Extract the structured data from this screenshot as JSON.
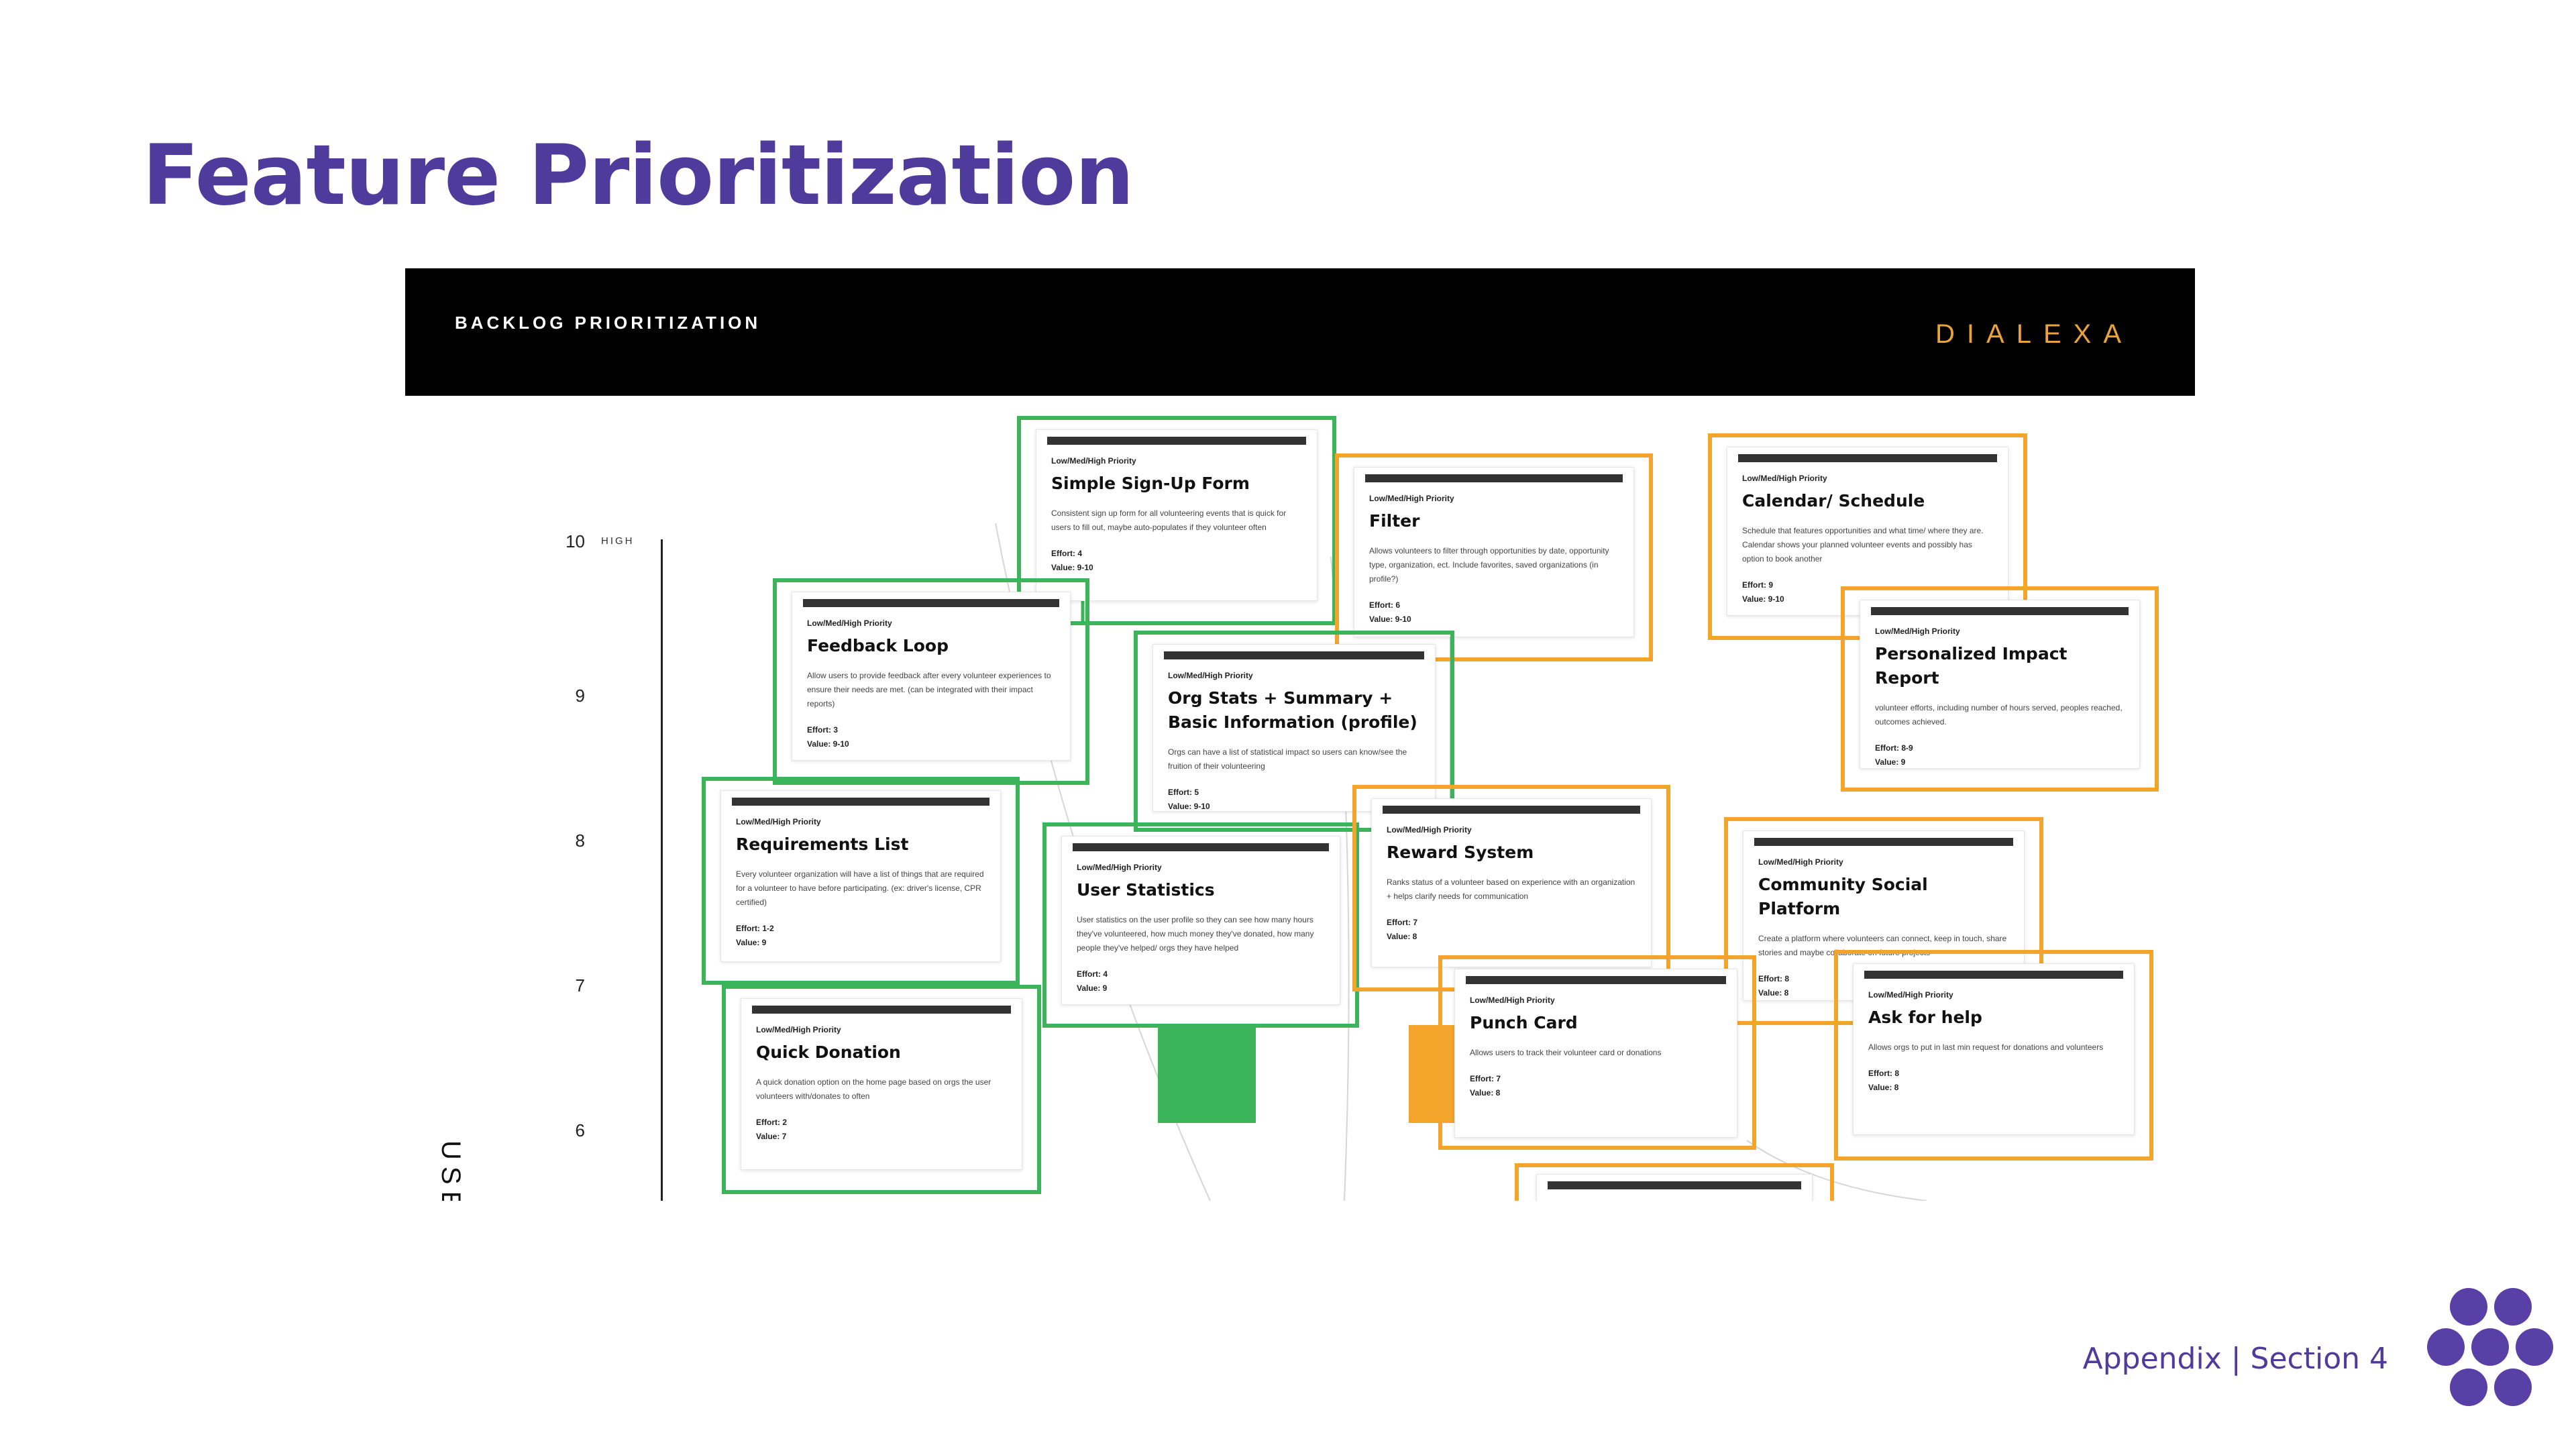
{
  "title": "Feature Prioritization",
  "board": {
    "header_title": "BACKLOG PRIORITIZATION",
    "brand": "DIALEXA",
    "y_axis": {
      "title": "USER",
      "high_label": "HIGH",
      "ticks": [
        "10",
        "9",
        "8",
        "7",
        "6"
      ]
    }
  },
  "cards": [
    {
      "priority": "Low/Med/High Priority",
      "title": "Simple Sign-Up Form",
      "desc": "Consistent sign up form for all volunteering events that is quick for users to fill out, maybe auto-populates if they volunteer often",
      "effort": "Effort: 4",
      "value": "Value: 9-10",
      "frame": "green"
    },
    {
      "priority": "Low/Med/High Priority",
      "title": "Filter",
      "desc": "Allows volunteers to filter through opportunities by date, opportunity type, organization, ect. Include favorites, saved organizations (in profile?)",
      "effort": "Effort: 6",
      "value": "Value: 9-10",
      "frame": "orange"
    },
    {
      "priority": "Low/Med/High Priority",
      "title": "Calendar/ Schedule",
      "desc": "Schedule that features opportunities and what time/ where they are. Calendar shows your planned volunteer events and possibly has option to book another",
      "effort": "Effort: 9",
      "value": "Value: 9-10",
      "frame": "orange"
    },
    {
      "priority": "Low/Med/High Priority",
      "title": "Feedback Loop",
      "desc": "Allow users to provide feedback after every volunteer experiences to ensure their needs are met. (can be integrated with their impact reports)",
      "effort": "Effort: 3",
      "value": "Value: 9-10",
      "frame": "green"
    },
    {
      "priority": "Low/Med/High Priority",
      "title": "Org Stats + Summary + Basic Information (profile)",
      "desc": "Orgs can have a list of statistical impact so users can know/see the fruition of their volunteering",
      "effort": "Effort: 5",
      "value": "Value: 9-10",
      "frame": "green"
    },
    {
      "priority": "Low/Med/High Priority",
      "title": "Personalized Impact Report",
      "desc": "volunteer efforts, including number of hours served, peoples reached, outcomes achieved.",
      "effort": "Effort: 8-9",
      "value": "Value: 9",
      "frame": "orange"
    },
    {
      "priority": "Low/Med/High Priority",
      "title": "Requirements List",
      "desc": "Every volunteer organization will have a list of things that are required for a volunteer to have before participating. (ex: driver's license, CPR certified)",
      "effort": "Effort: 1-2",
      "value": "Value: 9",
      "frame": "green"
    },
    {
      "priority": "Low/Med/High Priority",
      "title": "User Statistics",
      "desc": "User statistics on the user profile so they can see how many hours they've volunteered, how much money they've donated, how many people they've helped/ orgs they have helped",
      "effort": "Effort: 4",
      "value": "Value: 9",
      "frame": "green"
    },
    {
      "priority": "Low/Med/High Priority",
      "title": "Reward System",
      "desc": "Ranks status of a volunteer based on experience with an organization + helps clarify needs for communication",
      "effort": "Effort: 7",
      "value": "Value: 8",
      "frame": "orange"
    },
    {
      "priority": "Low/Med/High Priority",
      "title": "Community Social Platform",
      "desc": "Create a platform where volunteers can connect, keep in touch, share stories and maybe collaborate on future projects",
      "effort": "Effort: 8",
      "value": "Value: 8",
      "frame": "orange"
    },
    {
      "priority": "Low/Med/High Priority",
      "title": "Punch Card",
      "desc": "Allows users to track their volunteer card or donations",
      "effort": "Effort: 7",
      "value": "Value: 8",
      "frame": "orange"
    },
    {
      "priority": "Low/Med/High Priority",
      "title": "Ask for help",
      "desc": "Allows orgs to put in last min request for donations and volunteers",
      "effort": "Effort: 8",
      "value": "Value: 8",
      "frame": "orange"
    },
    {
      "priority": "Low/Med/High Priority",
      "title": "Quick Donation",
      "desc": "A quick donation option on the home page based on orgs the user volunteers with/donates to often",
      "effort": "Effort: 2",
      "value": "Value: 7",
      "frame": "green"
    }
  ],
  "colors": {
    "title": "#4f3b9c",
    "green": "#3cb55a",
    "orange": "#f3a42b",
    "brand": "#e8a33a",
    "dots": "#5840a6"
  },
  "footer": "Appendix | Section 4"
}
